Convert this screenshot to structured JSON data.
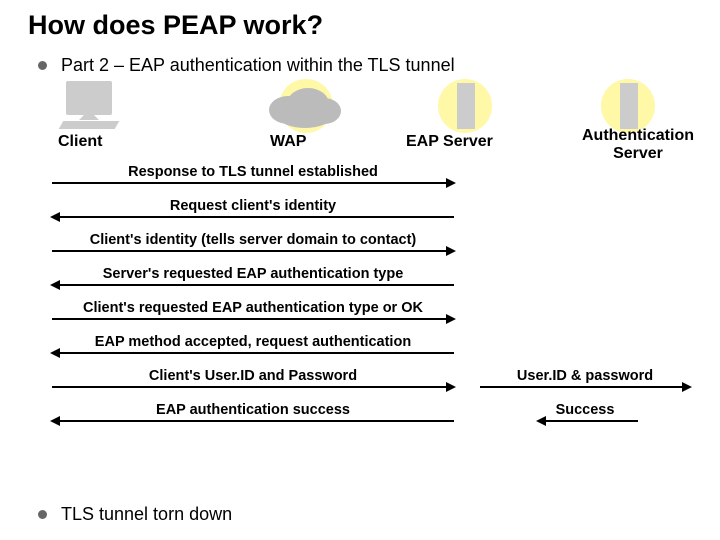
{
  "title": "How does PEAP work?",
  "subtitle": "Part 2 – EAP authentication within the TLS tunnel",
  "actors": {
    "client": "Client",
    "wap": "WAP",
    "eap": "EAP Server",
    "auth": "Authentication Server"
  },
  "messages": {
    "m1": "Response to TLS tunnel established",
    "m2": "Request client's identity",
    "m3": "Client's identity (tells server domain to contact)",
    "m4": "Server's requested EAP authentication type",
    "m5": "Client's requested EAP authentication type or OK",
    "m6": "EAP method accepted, request authentication",
    "m7": "Client's User.ID and Password",
    "m7b": "User.ID & password",
    "m8": "EAP authentication success",
    "m8b": "Success"
  },
  "footer": "TLS tunnel torn down",
  "colors": {
    "halo": "#fff8a6",
    "grey": "#cccccc",
    "bullet": "#666666"
  }
}
